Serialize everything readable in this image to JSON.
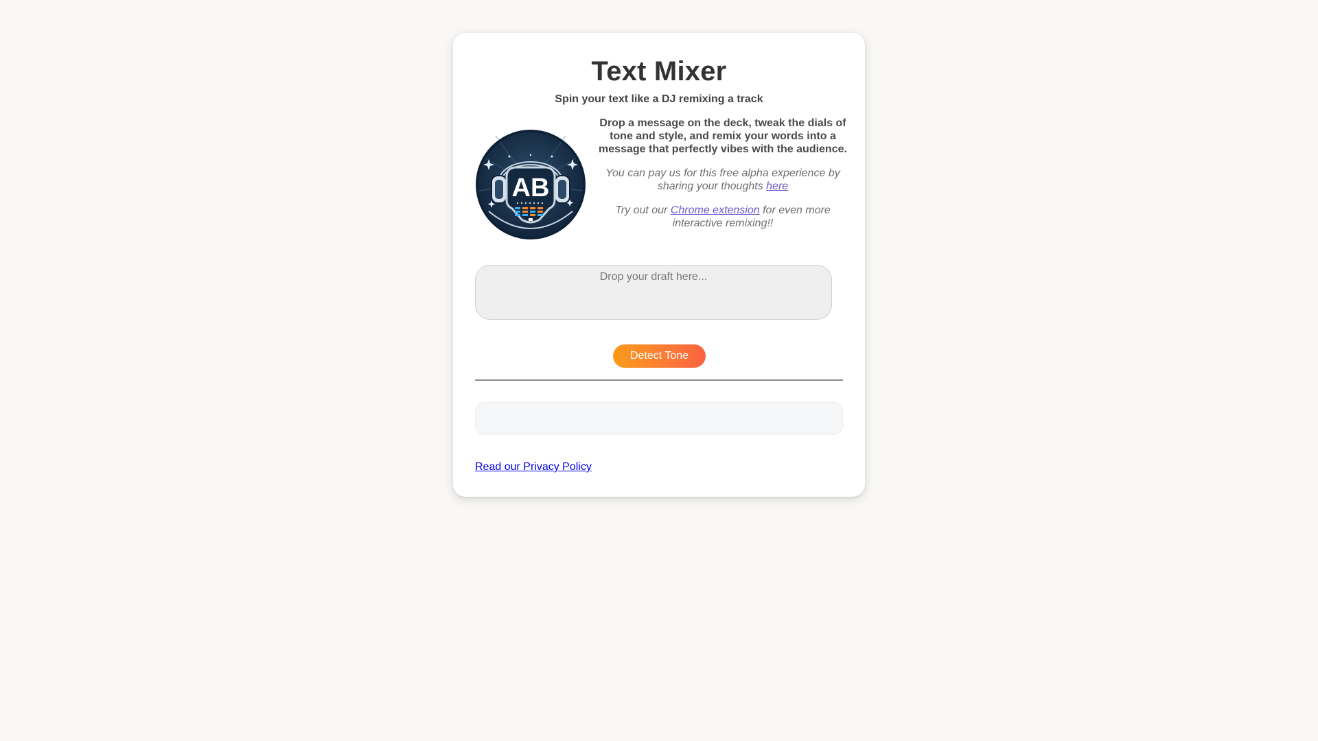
{
  "app": {
    "title": "Text Mixer",
    "subtitle": "Spin your text like a DJ remixing a track"
  },
  "logo": {
    "icon": "dj-headphones-logo",
    "monogram": "AB"
  },
  "info": {
    "description": "Drop a message on the deck, tweak the dials of tone and style, and remix your words into a message that perfectly vibes with the audience.",
    "feedback_prefix": "You can pay us for this free alpha experience by sharing your thoughts ",
    "feedback_link": "here",
    "extension_prefix": "Try out our ",
    "extension_link": "Chrome extension",
    "extension_suffix": " for even more interactive remixing!!"
  },
  "draft": {
    "placeholder": "Drop your draft here...",
    "value": ""
  },
  "actions": {
    "detect_label": "Detect Tone"
  },
  "output": {
    "text": ""
  },
  "footer": {
    "privacy_link": "Read our Privacy Policy"
  },
  "colors": {
    "page_background": "#f9f8f6",
    "card_background": "#ffffff",
    "button_gradient_start": "#fb9a1a",
    "button_gradient_end": "#f9623f",
    "link_color": "#6a5acd",
    "privacy_link_color": "#0000ee"
  }
}
